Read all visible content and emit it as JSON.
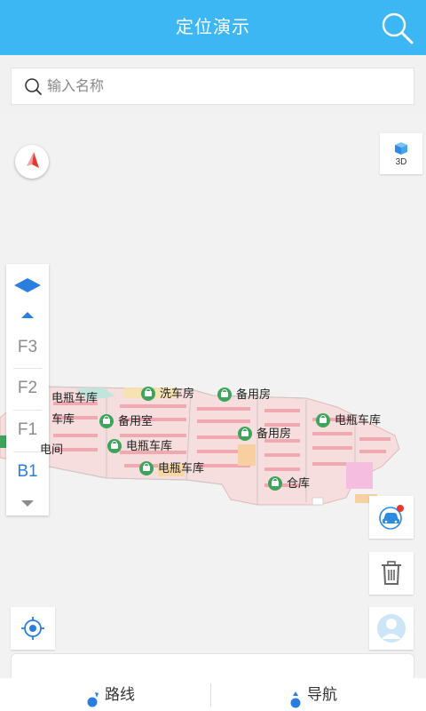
{
  "header": {
    "title": "定位演示",
    "search_icon": "search-icon"
  },
  "search": {
    "placeholder": "输入名称",
    "icon": "search-icon"
  },
  "controls": {
    "compass_icon": "compass-icon",
    "view_3d_label": "3D",
    "layers_icon": "layers-icon"
  },
  "floors": {
    "items": [
      "F3",
      "F2",
      "F1",
      "B1"
    ],
    "active": "B1"
  },
  "pois": [
    {
      "label": "电瓶车库"
    },
    {
      "label": "洗车房"
    },
    {
      "label": "备用房"
    },
    {
      "label": "车库"
    },
    {
      "label": "备用室"
    },
    {
      "label": "电瓶车库"
    },
    {
      "label": "备用房"
    },
    {
      "label": "电瓶车库"
    },
    {
      "label": "电瓶车库"
    },
    {
      "label": "仓库"
    },
    {
      "label": "电间"
    }
  ],
  "right_buttons": {
    "car": "car-icon",
    "trash": "trash-icon",
    "avatar": "avatar-icon"
  },
  "bottom": {
    "route_label": "路线",
    "nav_label": "导航"
  },
  "colors": {
    "accent": "#3db7f3",
    "floor_active": "#2a7fde",
    "poi_pin": "#3ea35b",
    "map_parking": "#f3bdbd"
  }
}
